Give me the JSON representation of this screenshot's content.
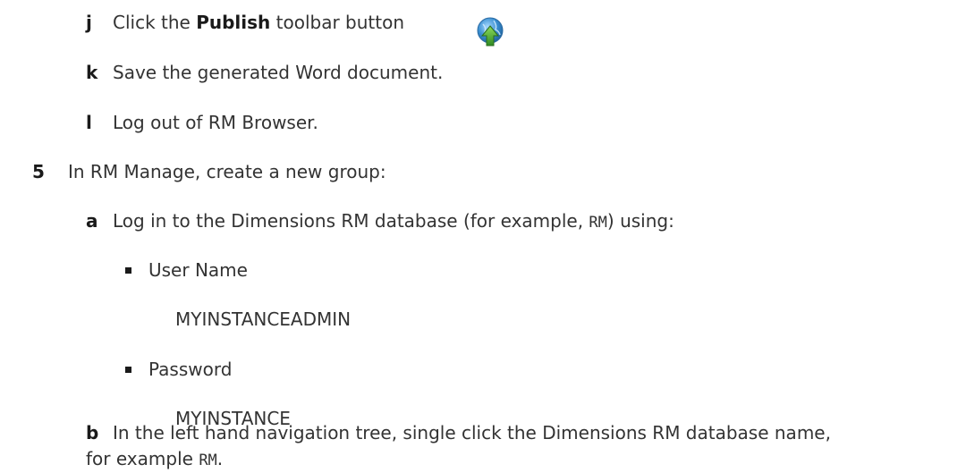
{
  "step_j": {
    "marker": "j",
    "text_before": "Click the ",
    "text_bold": "Publish",
    "text_after": " toolbar button",
    "icon": "publish-icon"
  },
  "step_k": {
    "marker": "k",
    "text": "Save the generated Word document."
  },
  "step_l": {
    "marker": "l",
    "text": "Log out of RM Browser."
  },
  "step_5": {
    "marker": "5",
    "text": "In RM Manage, create a new group:"
  },
  "step_a": {
    "marker": "a",
    "text_before": "Log in to the Dimensions RM database (for example, ",
    "code": "RM",
    "text_after": ") using:"
  },
  "bullets": [
    {
      "label": "User Name",
      "value": "MYINSTANCEADMIN"
    },
    {
      "label": "Password",
      "value": "MYINSTANCE"
    }
  ],
  "step_b": {
    "marker": "b",
    "line1": "In the left hand navigation tree, single click the Dimensions RM database name,",
    "line2_before": "for example ",
    "code": "RM",
    "line2_after": "."
  },
  "colors": {
    "text": "#333333",
    "icon_globe": "#3a8fd1",
    "icon_arrow": "#4caa3a"
  }
}
